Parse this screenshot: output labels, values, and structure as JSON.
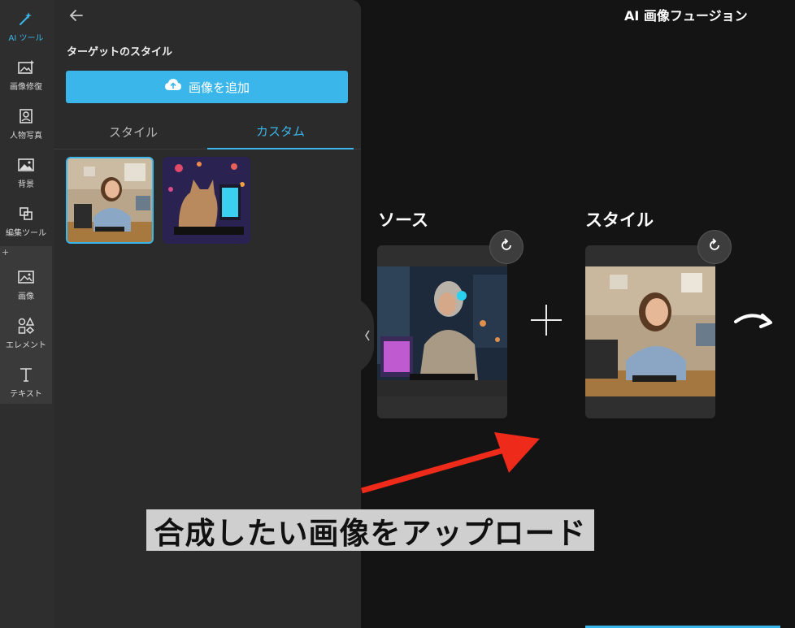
{
  "rail": {
    "items": [
      {
        "label": "AI ツール",
        "icon": "magic-wand-icon",
        "active": true
      },
      {
        "label": "画像修復",
        "icon": "image-repair-icon"
      },
      {
        "label": "人物写真",
        "icon": "portrait-icon"
      },
      {
        "label": "背景",
        "icon": "background-icon"
      },
      {
        "label": "編集ツール",
        "icon": "edit-tools-icon"
      },
      {
        "label": "画像",
        "icon": "image-icon"
      },
      {
        "label": "エレメント",
        "icon": "elements-icon"
      },
      {
        "label": "テキスト",
        "icon": "text-icon"
      }
    ],
    "plus_glyph": "+"
  },
  "panel": {
    "title": "ターゲットのスタイル",
    "add_button_label": "画像を追加",
    "tabs": [
      {
        "label": "スタイル",
        "active": false
      },
      {
        "label": "カスタム",
        "active": true
      }
    ]
  },
  "main": {
    "title": "AI 画像フュージョン",
    "source_label": "ソース",
    "style_label": "スタイル"
  },
  "annotation": {
    "caption": "合成したい画像をアップロード"
  },
  "colors": {
    "accent": "#3bb6ea",
    "arrow": "#ee2a1b"
  }
}
